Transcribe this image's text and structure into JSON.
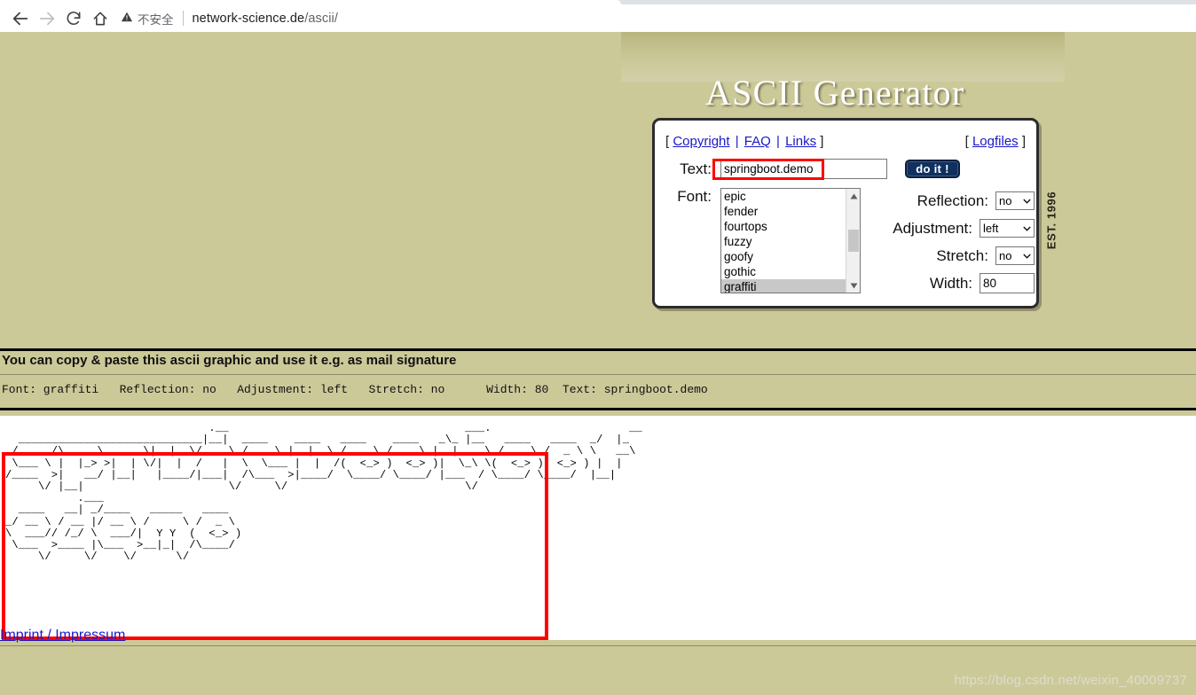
{
  "browser": {
    "back_icon": "arrow-left-icon",
    "forward_icon": "arrow-right-icon",
    "reload_icon": "reload-icon",
    "home_icon": "home-icon",
    "security_icon": "warning-triangle-icon",
    "security_label": "不安全",
    "url_host": "network-science.de",
    "url_path": "/ascii/"
  },
  "site": {
    "title": "ASCII Generator",
    "est_label": "EST. 1996"
  },
  "panel": {
    "bracket_open": "[",
    "bracket_close": "]",
    "separator": "|",
    "links": [
      {
        "label": "Copyright"
      },
      {
        "label": "FAQ"
      },
      {
        "label": "Links"
      }
    ],
    "logfiles_label": "Logfiles",
    "text_label": "Text:",
    "text_value": "springboot.demo",
    "text_placeholder": "",
    "do_it_label": "do it !",
    "font_label": "Font:",
    "font_options": [
      {
        "label": "epic",
        "selected": false
      },
      {
        "label": "fender",
        "selected": false
      },
      {
        "label": "fourtops",
        "selected": false
      },
      {
        "label": "fuzzy",
        "selected": false
      },
      {
        "label": "goofy",
        "selected": false
      },
      {
        "label": "gothic",
        "selected": false
      },
      {
        "label": "graffiti",
        "selected": true
      }
    ],
    "scroll_up_icon": "triangle-up-icon",
    "scroll_down_icon": "triangle-down-icon",
    "options": [
      {
        "label": "Reflection:",
        "value": "no"
      },
      {
        "label": "Adjustment:",
        "value": "left"
      },
      {
        "label": "Stretch:",
        "value": "no"
      }
    ],
    "width_label": "Width:",
    "width_value": "80"
  },
  "result": {
    "copy_hint": "You can copy & paste this ascii graphic and use it e.g. as mail signature",
    "params_line": "Font: graffiti   Reflection: no   Adjustment: left   Stretch: no      Width: 80  Text: springboot.demo",
    "ascii_art": "                               .__                                    ___.                     __\n  ____________________________|__|  ____    ____   ____    ____   _\\_ |__   ____   ____  _/  |_\n /  ___/\\____ \\_  __ \\|  |  \\/    \\ / ___\\ |  |  \\ /  _ \\ /  _ \\ |  | __ \\ /  _ \\ /  _ \\ \\   __\\\n \\___ \\ |  |_> >|  | \\/|  |  /   |  \\  \\___ |  |  /(  <_> )  <_> )|  \\_\\ \\(  <_> )  <_> ) |  |\n/____  >|   __/ |__|   |____/|___|  /\\___  >|____/  \\____/ \\____/ |___  / \\____/ \\____/  |__|\n     \\/ |__|                      \\/     \\/                           \\/\n           .___\n  ____   __| _/____   _____   ____\n_/ __ \\ / __ |/ __ \\ /     \\ /  _ \\\n\\  ___// /_/ \\  ___/|  Y Y  (  <_> )\n \\___  >____ |\\___  >__|_|  /\\____/\n     \\/     \\/    \\/      \\/"
  },
  "footer": {
    "imprint_label": "Imprint / Impressum",
    "watermark": "https://blog.csdn.net/weixin_40009737"
  },
  "colors": {
    "page_background": "#ccc999",
    "panel_background": "#ffffff",
    "link": "#1a18c8",
    "button": "#10305f",
    "annotation": "#ff0000",
    "title_text": "#ffffff"
  }
}
